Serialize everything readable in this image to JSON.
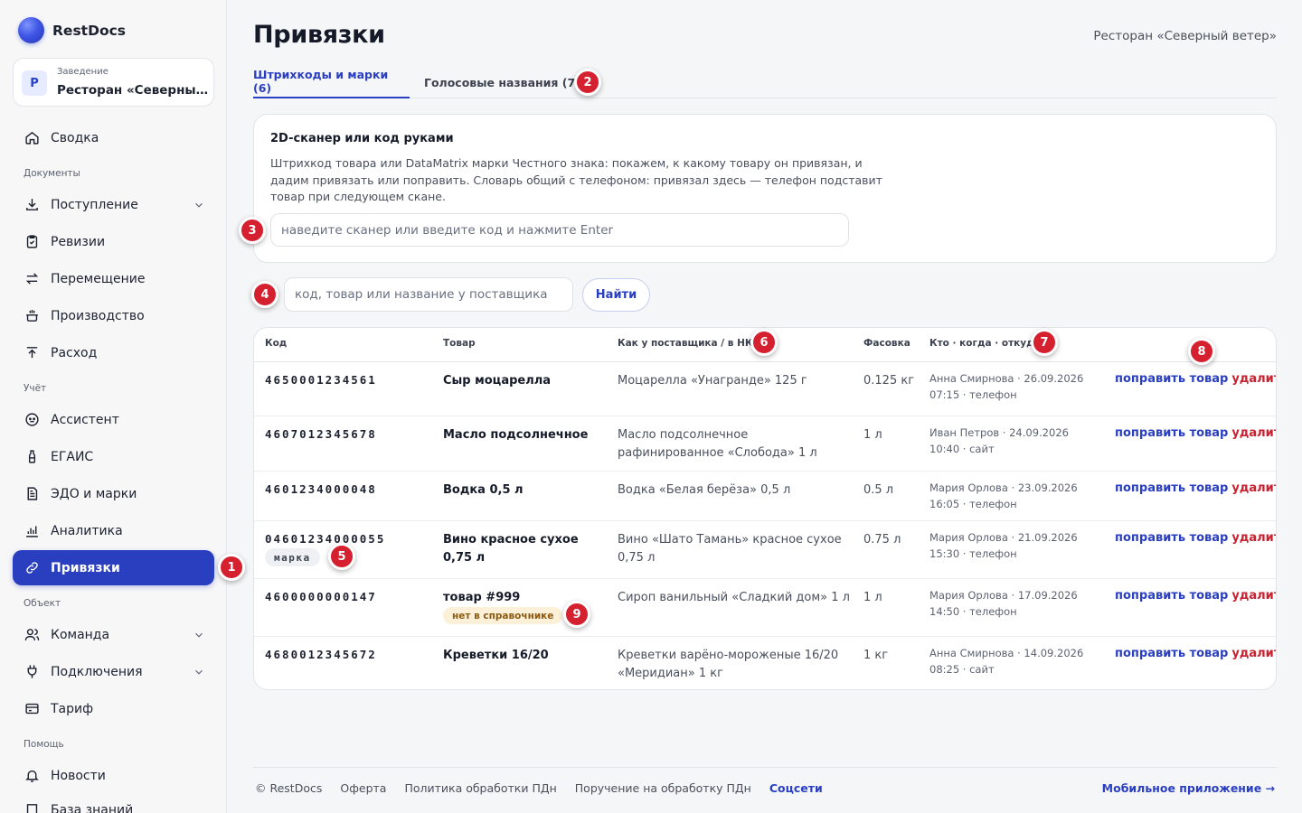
{
  "brand": {
    "name": "RestDocs"
  },
  "venue": {
    "avatar": "Р",
    "label": "Заведение",
    "name": "Ресторан «Северный ветер»"
  },
  "nav": {
    "summary": "Сводка",
    "section_docs": "Документы",
    "receiving": "Поступление",
    "audits": "Ревизии",
    "transfer": "Перемещение",
    "production": "Производство",
    "expense": "Расход",
    "section_accounting": "Учёт",
    "assistant": "Ассистент",
    "egais": "ЕГАИС",
    "edo": "ЭДО и марки",
    "analytics": "Аналитика",
    "bindings": "Привязки",
    "section_object": "Объект",
    "team": "Команда",
    "connections": "Подключения",
    "tariff": "Тариф",
    "section_help": "Помощь",
    "news": "Новости",
    "kb": "База знаний"
  },
  "page": {
    "title": "Привязки",
    "venue": "Ресторан «Северный ветер»"
  },
  "tabs": {
    "barcodes": "Штрихкоды и марки (6)",
    "voice": "Голосовые названия (7)"
  },
  "scanner": {
    "title": "2D-сканер или код руками",
    "desc": "Штрихкод товара или DataMatrix марки Честного знака: покажем, к какому товару он привязан, и дадим привязать или поправить. Словарь общий с телефоном: привязал здесь — телефон подставит товар при следующем скане.",
    "placeholder": "наведите сканер или введите код и нажмите Enter"
  },
  "search": {
    "placeholder": "код, товар или название у поставщика",
    "button": "Найти"
  },
  "table": {
    "headers": {
      "code": "Код",
      "product": "Товар",
      "supplier": "Как у поставщика / в НКТ",
      "pack": "Фасовка",
      "who": "Кто · когда · откуда"
    },
    "action_fix": "поправить товар",
    "action_delete": "удалить",
    "tag_mark": "марка",
    "tag_missing": "нет в справочнике",
    "rows": [
      {
        "code": "4650001234561",
        "product": "Сыр моцарелла",
        "supplier": "Моцарелла «Унагранде» 125 г",
        "pack": "0.125 кг",
        "who1": "Анна Смирнова · 26.09.2026",
        "who2": "07:15 · телефон"
      },
      {
        "code": "4607012345678",
        "product": "Масло подсолнечное",
        "supplier": "Масло подсолнечное рафинированное «Слобода» 1 л",
        "pack": "1 л",
        "who1": "Иван Петров · 24.09.2026",
        "who2": "10:40 · сайт"
      },
      {
        "code": "4601234000048",
        "product": "Водка 0,5 л",
        "supplier": "Водка «Белая берёза» 0,5 л",
        "pack": "0.5 л",
        "who1": "Мария Орлова · 23.09.2026",
        "who2": "16:05 · телефон"
      },
      {
        "code": "04601234000055",
        "product": "Вино красное сухое 0,75 л",
        "supplier": "Вино «Шато Тамань» красное сухое 0,75 л",
        "pack": "0.75 л",
        "who1": "Мария Орлова · 21.09.2026",
        "who2": "15:30 · телефон"
      },
      {
        "code": "4600000000147",
        "product": "товар #999",
        "supplier": "Сироп ванильный «Сладкий дом» 1 л",
        "pack": "1 л",
        "who1": "Мария Орлова · 17.09.2026",
        "who2": "14:50 · телефон"
      },
      {
        "code": "4680012345672",
        "product": "Креветки 16/20",
        "supplier": "Креветки варёно-мороженые 16/20 «Меридиан» 1 кг",
        "pack": "1 кг",
        "who1": "Анна Смирнова · 14.09.2026",
        "who2": "08:25 · сайт"
      }
    ]
  },
  "footer": {
    "copyright": "© RestDocs",
    "offer": "Оферта",
    "policy": "Политика обработки ПДн",
    "order": "Поручение на обработку ПДн",
    "social": "Соцсети",
    "mobile": "Мобильное приложение →"
  },
  "markers": [
    "1",
    "2",
    "3",
    "4",
    "5",
    "6",
    "7",
    "8",
    "9"
  ],
  "colors": {
    "accent": "#2a3fc0",
    "danger": "#c8202e",
    "marker": "#d5202f"
  }
}
